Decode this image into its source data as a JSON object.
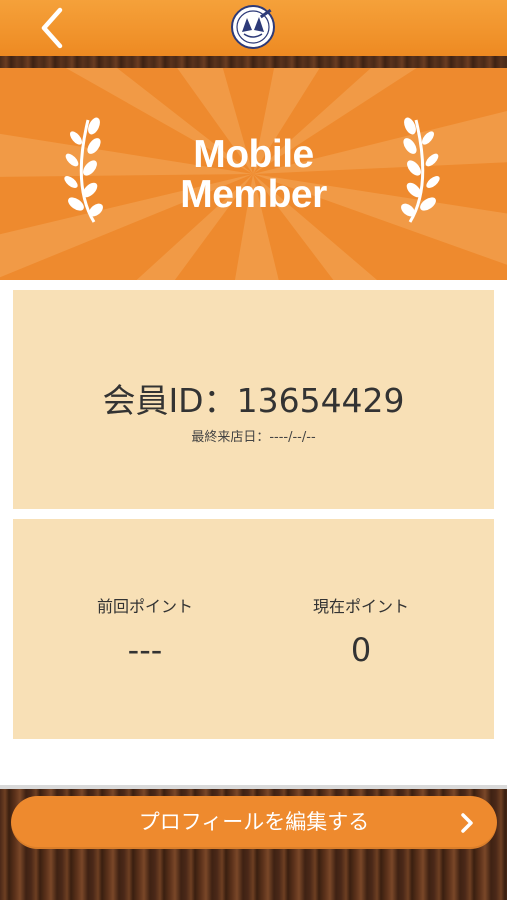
{
  "header": {
    "back_icon": "chevron-left-icon",
    "logo_icon": "club-emblem-logo"
  },
  "hero": {
    "title_line1": "Mobile",
    "title_line2": "Member",
    "decoration_icon": "laurel-branch-icon"
  },
  "member": {
    "id_text": "会員ID：13654429",
    "last_visit_text": "最終来店日：----/--/--"
  },
  "points": {
    "previous_label": "前回ポイント",
    "previous_value": "---",
    "current_label": "現在ポイント",
    "current_value": "0"
  },
  "footer": {
    "edit_profile_label": "プロフィールを編集する",
    "edit_icon": "chevron-right-icon"
  },
  "colors": {
    "accent_orange": "#ee8a2e",
    "card_beige": "#f8e0b6",
    "wood_brown": "#4a2a18"
  }
}
